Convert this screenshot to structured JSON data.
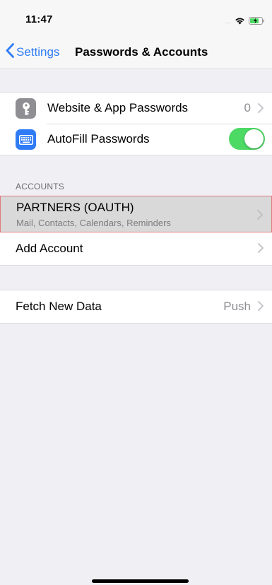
{
  "status_bar": {
    "time": "11:47",
    "signal": "....",
    "icons": [
      "wifi-icon",
      "battery-charging-icon"
    ]
  },
  "nav": {
    "back_label": "Settings",
    "title": "Passwords & Accounts"
  },
  "passwords_group": [
    {
      "label": "Website & App Passwords",
      "value": "0",
      "icon": "key-icon"
    },
    {
      "label": "AutoFill Passwords",
      "toggle": true,
      "icon": "keyboard-icon"
    }
  ],
  "accounts": {
    "header": "ACCOUNTS",
    "items": [
      {
        "name": "PARTNERS (OAUTH)",
        "subtitle": "Mail, Contacts, Calendars, Reminders"
      }
    ],
    "add_label": "Add Account"
  },
  "fetch": {
    "label": "Fetch New Data",
    "value": "Push"
  },
  "colors": {
    "accent": "#2f7cf6",
    "toggle_on": "#4cd964",
    "selected_outline": "#e07a7a"
  }
}
